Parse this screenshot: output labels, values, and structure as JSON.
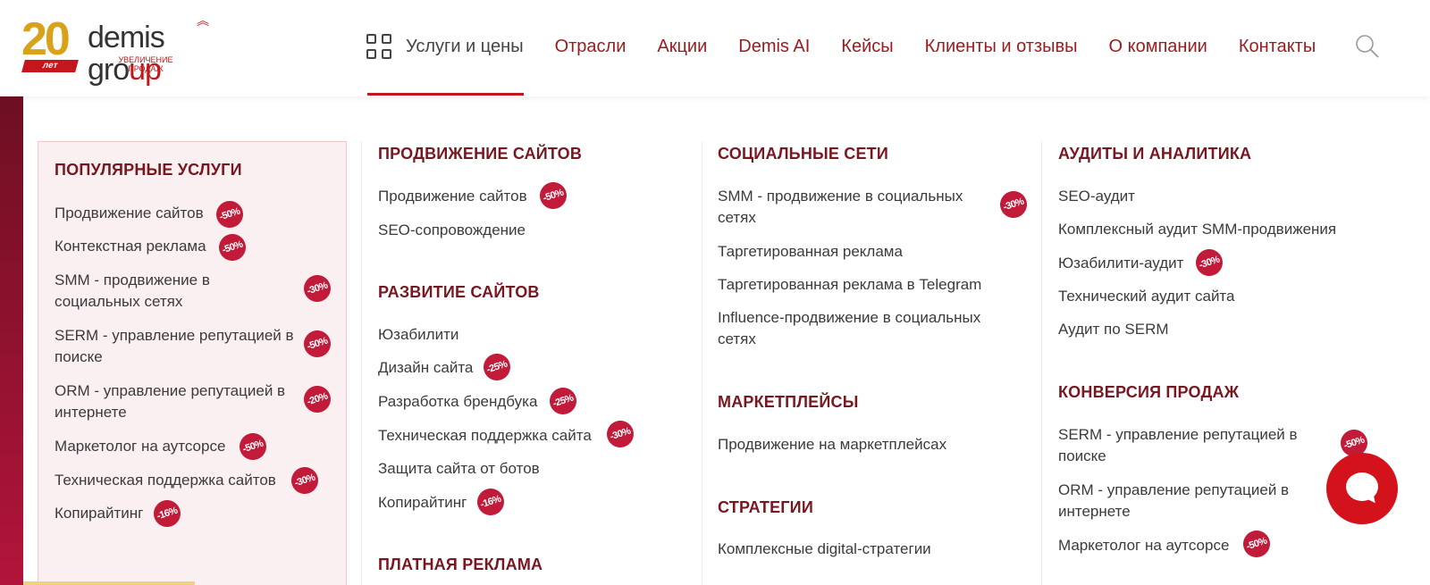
{
  "logo": {
    "anniversary": "20",
    "years": "лет",
    "name_start": "demis gro",
    "name_end": "up",
    "tagline": "увеличение продаж"
  },
  "nav": {
    "items": [
      {
        "label": "Услуги и цены",
        "active": true
      },
      {
        "label": "Отрасли"
      },
      {
        "label": "Акции"
      },
      {
        "label": "Demis AI"
      },
      {
        "label": "Кейсы"
      },
      {
        "label": "Клиенты и отзывы"
      },
      {
        "label": "О компании"
      },
      {
        "label": "Контакты"
      }
    ]
  },
  "popular": {
    "title": "ПОПУЛЯРНЫЕ УСЛУГИ",
    "items": [
      {
        "label": "Продвижение сайтов",
        "badge": "-50%"
      },
      {
        "label": "Контекстная реклама",
        "badge": "-50%"
      },
      {
        "label": "SMM - продвижение в социальных сетях",
        "badge": "-30%"
      },
      {
        "label": "SERM - управление репутацией в поиске",
        "badge": "-50%"
      },
      {
        "label": "ORM - управление репутацией в интернете",
        "badge": "-20%"
      },
      {
        "label": "Маркетолог на аутсорсе",
        "badge": "-50%"
      },
      {
        "label": "Техническая поддержка сайтов",
        "badge": "-30%"
      },
      {
        "label": "Копирайтинг",
        "badge": "-16%"
      }
    ]
  },
  "col2": {
    "sections": [
      {
        "title": "ПРОДВИЖЕНИЕ САЙТОВ",
        "items": [
          {
            "label": "Продвижение сайтов",
            "badge": "-50%"
          },
          {
            "label": "SEO-сопровождение"
          }
        ]
      },
      {
        "title": "РАЗВИТИЕ САЙТОВ",
        "items": [
          {
            "label": "Юзабилити"
          },
          {
            "label": "Дизайн сайта",
            "badge": "-25%"
          },
          {
            "label": "Разработка брендбука",
            "badge": "-25%"
          },
          {
            "label": "Техническая поддержка сайта",
            "badge": "-30%"
          },
          {
            "label": "Защита сайта от ботов"
          },
          {
            "label": "Копирайтинг",
            "badge": "-16%"
          }
        ]
      },
      {
        "title": "ПЛАТНАЯ РЕКЛАМА",
        "items": []
      }
    ]
  },
  "col3": {
    "sections": [
      {
        "title": "СОЦИАЛЬНЫЕ СЕТИ",
        "items": [
          {
            "label": "SMM - продвижение в социальных сетях",
            "badge": "-30%"
          },
          {
            "label": "Таргетированная реклама"
          },
          {
            "label": "Таргетированная реклама в Telegram"
          },
          {
            "label": "Influence-продвижение в социальных сетях"
          }
        ]
      },
      {
        "title": "МАРКЕТПЛЕЙСЫ",
        "items": [
          {
            "label": "Продвижение на маркетплейсах"
          }
        ]
      },
      {
        "title": "СТРАТЕГИИ",
        "items": [
          {
            "label": "Комплексные digital-стратегии"
          }
        ]
      }
    ]
  },
  "col4": {
    "sections": [
      {
        "title": "АУДИТЫ И АНАЛИТИКА",
        "items": [
          {
            "label": "SEO-аудит"
          },
          {
            "label": "Комплексный аудит SMM-продвижения"
          },
          {
            "label": "Юзабилити-аудит",
            "badge": "-30%"
          },
          {
            "label": "Технический аудит сайта"
          },
          {
            "label": "Аудит по SERM"
          }
        ]
      },
      {
        "title": "КОНВЕРСИЯ ПРОДАЖ",
        "items": [
          {
            "label": "SERM - управление репутацией в поиске",
            "badge": "-50%"
          },
          {
            "label": "ORM - управление репутацией в интернете"
          },
          {
            "label": "Маркетолог на аутсорсе",
            "badge": "-50%"
          }
        ]
      }
    ]
  },
  "colors": {
    "brand_red": "#c4161c",
    "title_red": "#7a1620",
    "badge_red": "#c21b3a",
    "gold": "#d9a21b"
  },
  "icons": {
    "menu": "grid-icon",
    "search": "search-icon",
    "chat": "chat-icon"
  }
}
